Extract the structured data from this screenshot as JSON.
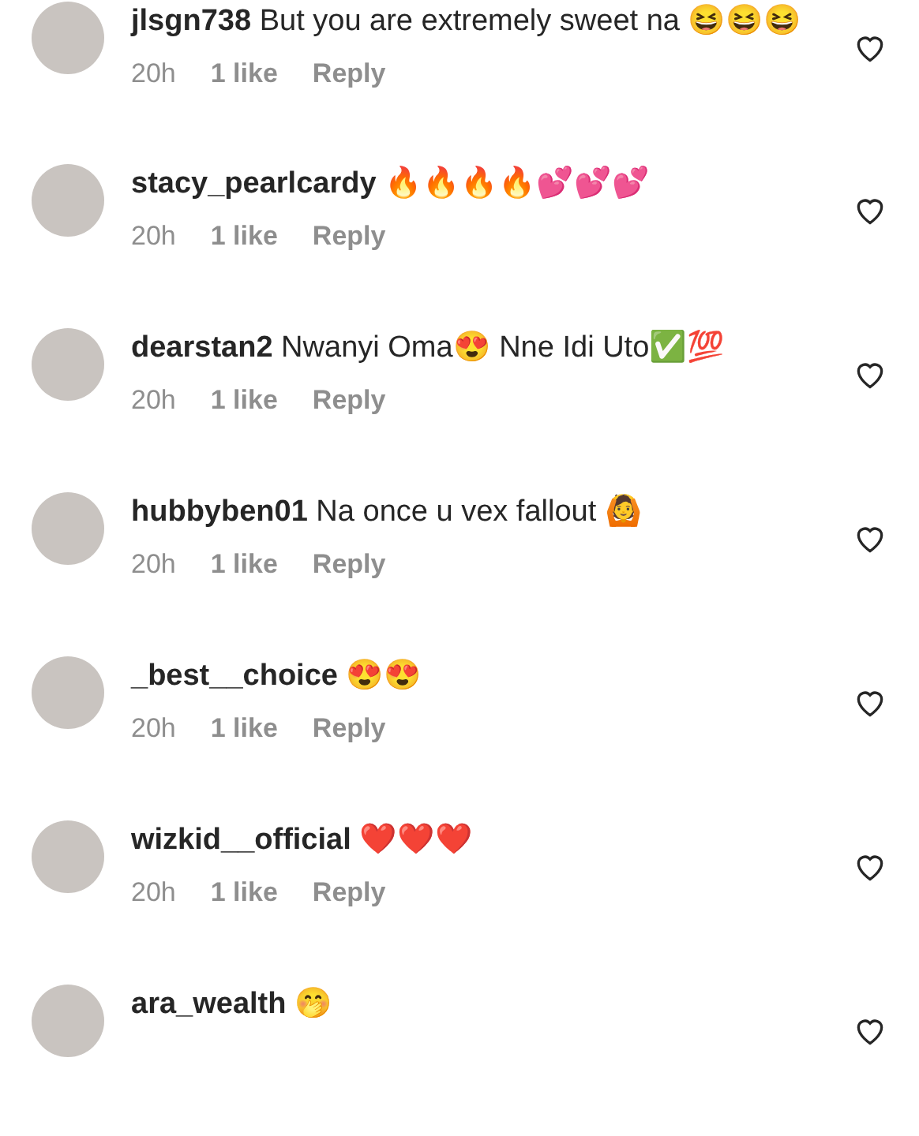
{
  "comments": [
    {
      "username": "jlsgn738",
      "text": "But you are extremely sweet na 😆😆😆",
      "time": "20h",
      "likes": "1 like",
      "reply": "Reply",
      "liked": false
    },
    {
      "username": "stacy_pearlcardy",
      "text": "🔥🔥🔥🔥💕💕💕",
      "time": "20h",
      "likes": "1 like",
      "reply": "Reply",
      "liked": false
    },
    {
      "username": "dearstan2",
      "text": "Nwanyi Oma😍 Nne Idi Uto✅💯",
      "time": "20h",
      "likes": "1 like",
      "reply": "Reply",
      "liked": false
    },
    {
      "username": "hubbyben01",
      "text": "Na once u vex fallout 🙆",
      "time": "20h",
      "likes": "1 like",
      "reply": "Reply",
      "liked": false
    },
    {
      "username": "_best__choice",
      "text": "😍😍",
      "time": "20h",
      "likes": "1 like",
      "reply": "Reply",
      "liked": false
    },
    {
      "username": "wizkid__official",
      "text": "❤️❤️❤️",
      "time": "20h",
      "likes": "1 like",
      "reply": "Reply",
      "liked": false
    },
    {
      "username": "ara_wealth",
      "text": "🤭",
      "liked": false
    }
  ]
}
